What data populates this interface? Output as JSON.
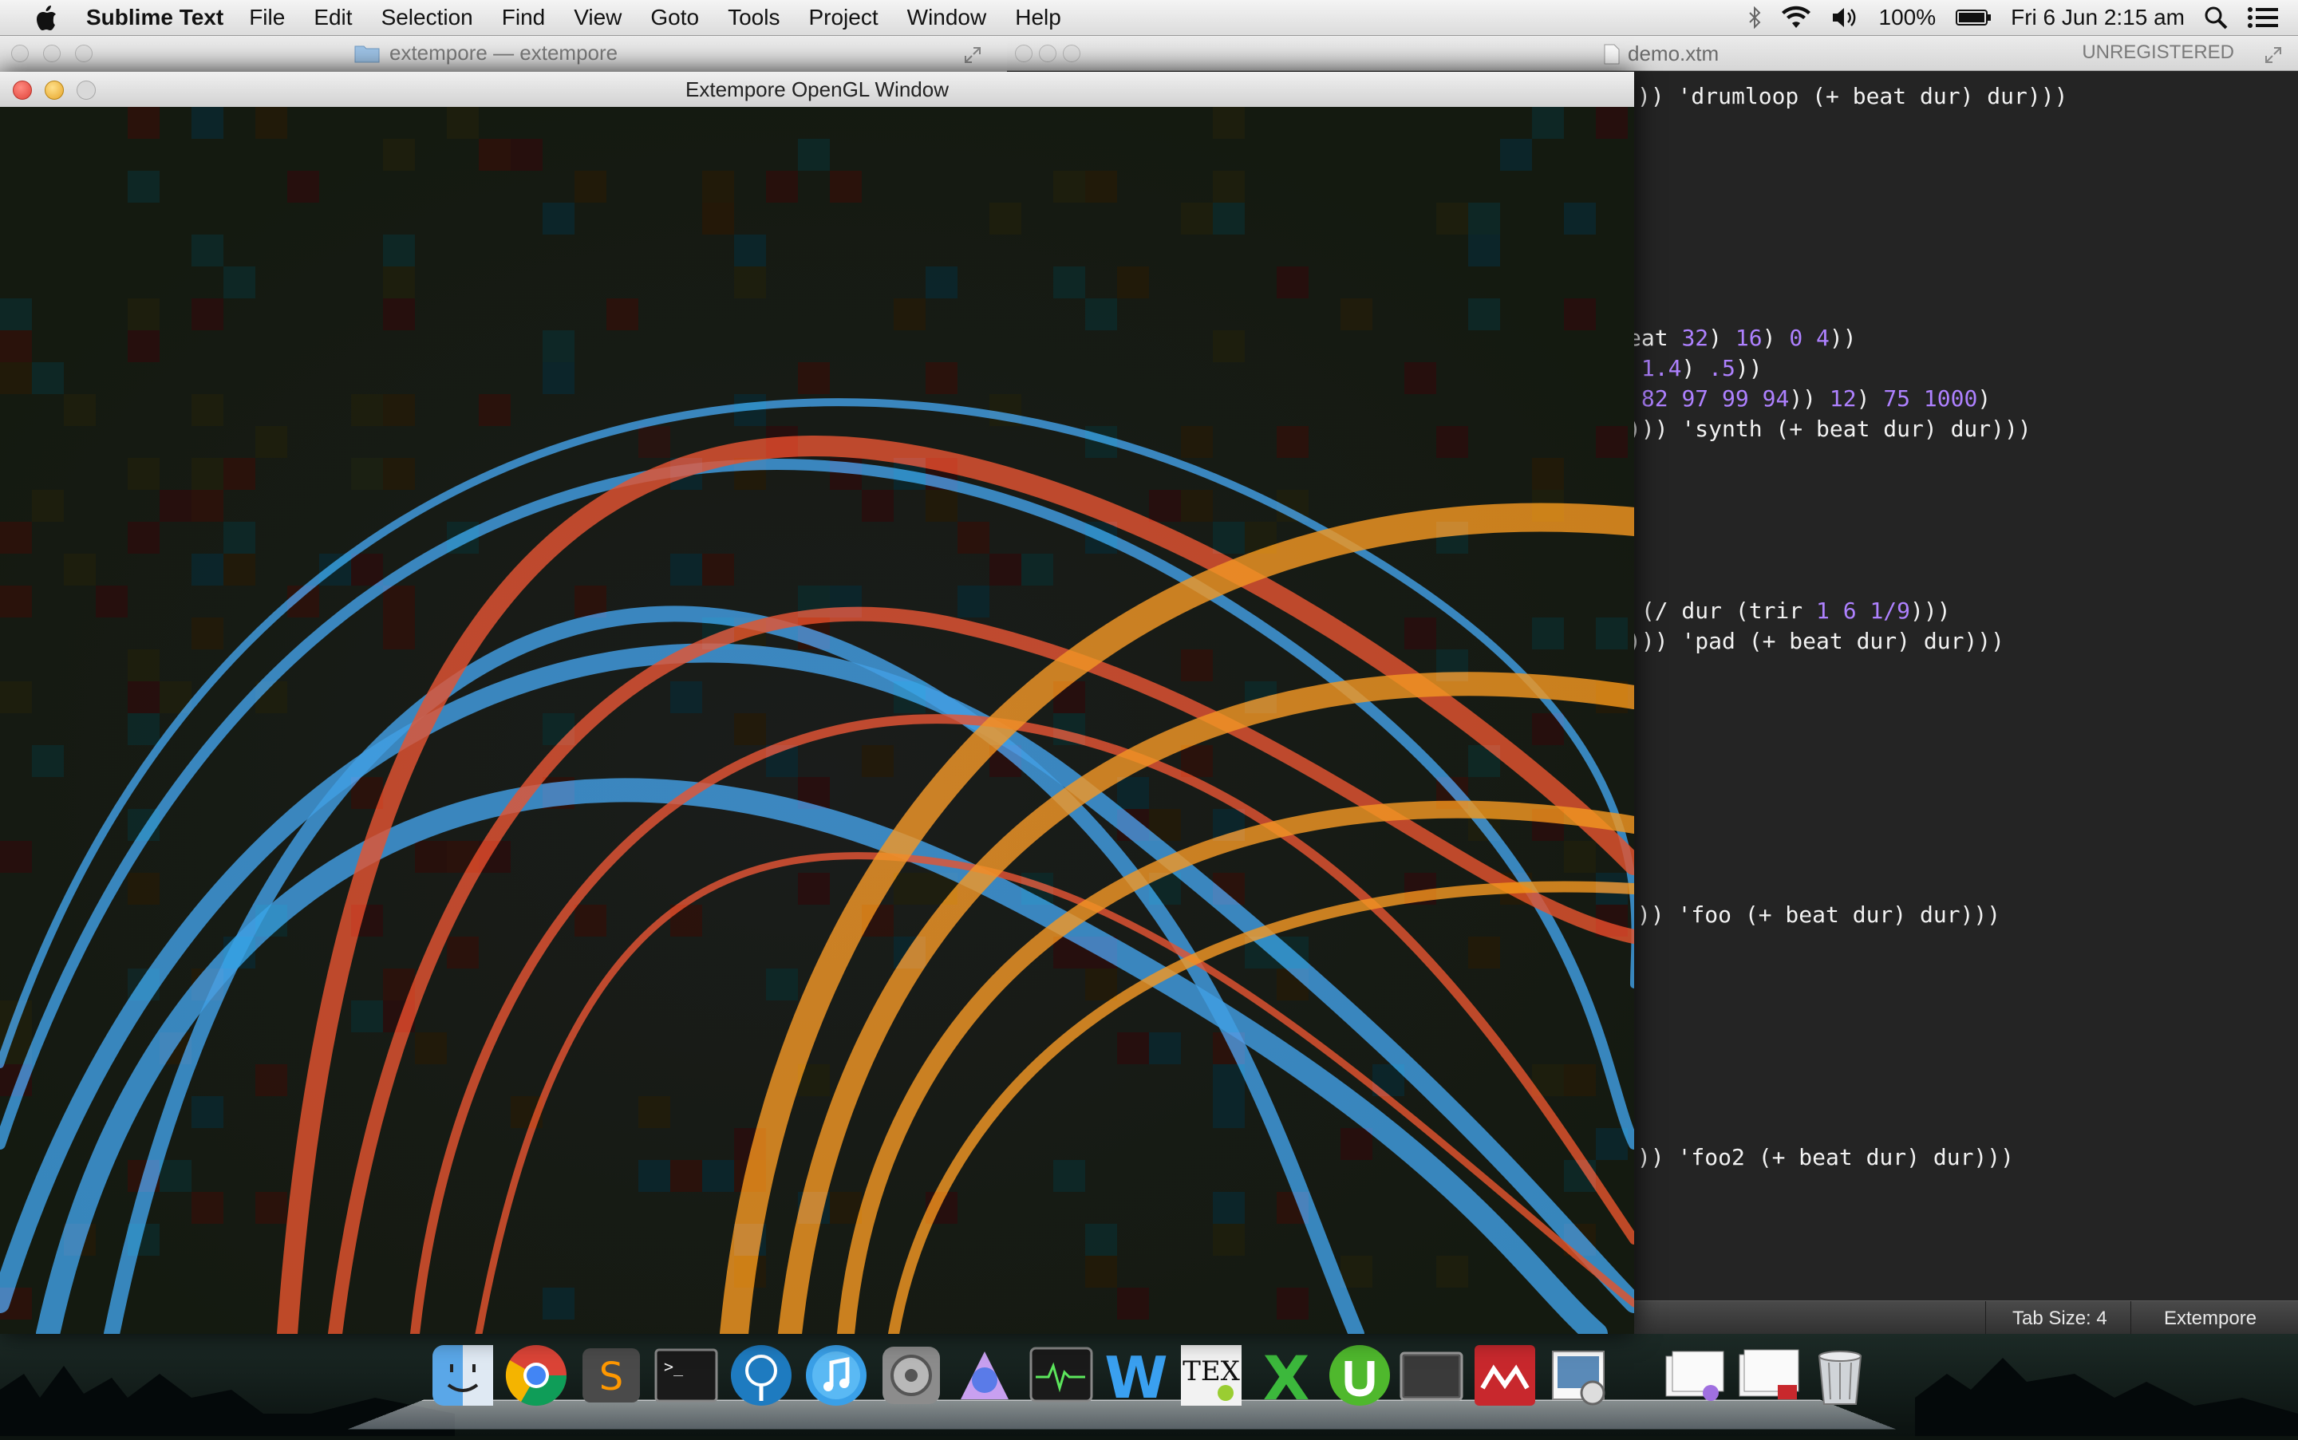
{
  "menubar": {
    "app_name": "Sublime Text",
    "menus": [
      "File",
      "Edit",
      "Selection",
      "Find",
      "View",
      "Goto",
      "Tools",
      "Project",
      "Window",
      "Help"
    ],
    "battery": "100%",
    "clock": "Fri 6 Jun  2:15 am"
  },
  "finder_window": {
    "title": "extempore — extempore"
  },
  "opengl_window": {
    "title": "Extempore OpenGL Window"
  },
  "sublime": {
    "doc_title": "demo.xtm",
    "license": "UNREGISTERED",
    "code_lines": [
      ")) 'drumloop (+ beat dur) dur)))",
      "eat 32) 16) 0 4))",
      " 1.4) .5))",
      " 82 97 99 94)) 12) 75 1000)",
      "))) 'synth (+ beat dur) dur)))",
      " (/ dur (trir 1 6 1/9)))",
      "))) 'pad (+ beat dur) dur)))",
      ")) 'foo (+ beat dur) dur)))",
      ")) 'foo2 (+ beat dur) dur)))"
    ],
    "status": {
      "tab_size": "Tab Size: 4",
      "syntax": "Extempore"
    }
  },
  "dock": {
    "items": [
      "finder-icon",
      "chrome-icon",
      "sublime-text-icon",
      "terminal-icon",
      "sourcetree-icon",
      "itunes-icon",
      "system-preferences-icon",
      "xcode-instruments-icon",
      "activity-monitor-icon",
      "word-icon",
      "tex-shop-icon",
      "excel-icon",
      "utorrent-icon",
      "console-icon",
      "mendeley-icon",
      "preview-icon",
      "document-stack-icon",
      "downloads-stack-icon",
      "trash-icon"
    ]
  },
  "colors": {
    "editor_bg": "#242424",
    "number": "#ae81ff",
    "arc_blue": "#2e93e0",
    "arc_red": "#e0401e",
    "arc_orange": "#f08a10"
  }
}
